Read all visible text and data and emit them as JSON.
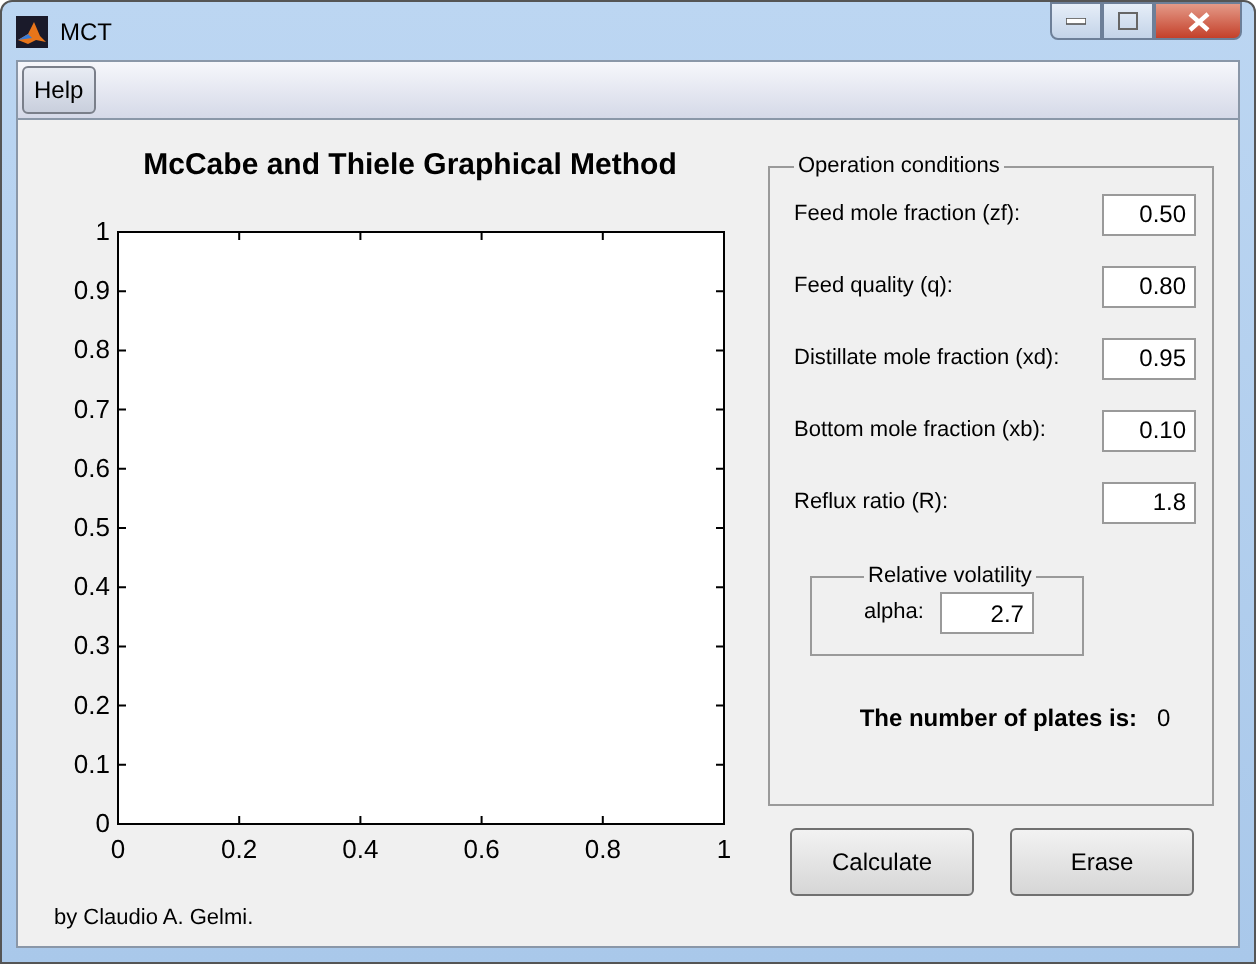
{
  "window": {
    "title": "MCT"
  },
  "menu": [
    {
      "label": "Help"
    }
  ],
  "plot": {
    "chart_data": {
      "type": "line",
      "title": "McCabe and Thiele Graphical Method",
      "xlim": [
        0,
        1
      ],
      "ylim": [
        0,
        1
      ],
      "xticks": [
        0,
        0.2,
        0.4,
        0.6,
        0.8,
        1
      ],
      "yticks": [
        0,
        0.1,
        0.2,
        0.3,
        0.4,
        0.5,
        0.6,
        0.7,
        0.8,
        0.9,
        1
      ]
    }
  },
  "credit": "by Claudio A. Gelmi.",
  "operation_conditions": {
    "title": "Operation conditions",
    "fields": [
      {
        "label": "Feed mole fraction (zf):",
        "value": "0.50"
      },
      {
        "label": "Feed quality (q):",
        "value": "0.80"
      },
      {
        "label": "Distillate mole fraction (xd):",
        "value": "0.95"
      },
      {
        "label": "Bottom mole fraction (xb):",
        "value": "0.10"
      },
      {
        "label": "Reflux ratio (R):",
        "value": "1.8"
      }
    ]
  },
  "relative_volatility": {
    "title": "Relative volatility",
    "field": {
      "label": "alpha:",
      "value": "2.7"
    }
  },
  "result": {
    "label": "The number of plates is:",
    "value": "0"
  },
  "buttons": [
    "Calculate",
    "Erase"
  ]
}
